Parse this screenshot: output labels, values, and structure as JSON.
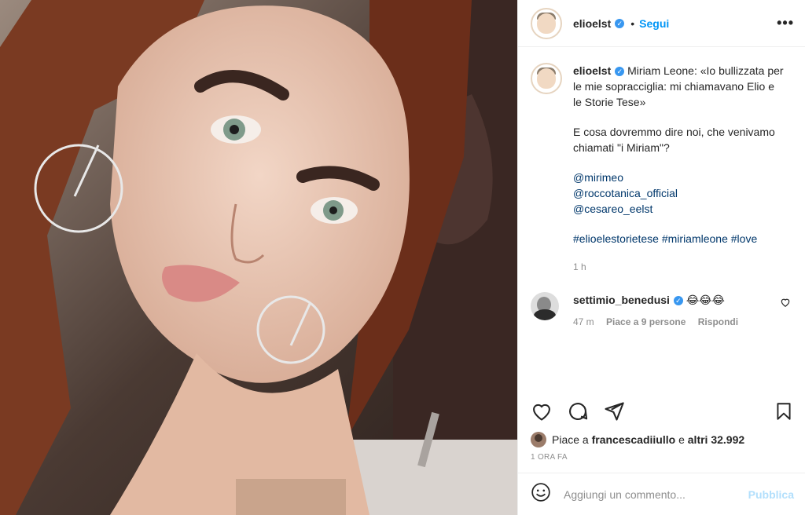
{
  "post_header": {
    "username": "elioelst",
    "dot": "•",
    "follow_label": "Segui",
    "more_label": "•••"
  },
  "caption": {
    "username": "elioelst",
    "text": "Miriam Leone: «Io bullizzata per le mie sopracciglia: mi chiamavano Elio e le Storie Tese»",
    "text2": "E cosa dovremmo dire noi, che venivamo chiamati \"i Miriam\"?",
    "mentions": [
      "@mirimeo",
      "@roccotanica_official",
      "@cesareo_eelst"
    ],
    "hashtags": "#elioelestorietese #miriamleone #love",
    "time": "1 h"
  },
  "comment": {
    "username": "settimio_benedusi",
    "text": "😂😂😂",
    "time": "47 m",
    "likes": "Piace a 9 persone",
    "reply": "Rispondi"
  },
  "likes": {
    "prefix": "Piace a",
    "user": "francescadiiullo",
    "middle": "e",
    "others": "altri 32.992"
  },
  "posted_ago": "1 ORA FA",
  "add_comment": {
    "placeholder": "Aggiungi un commento...",
    "publish_label": "Pubblica"
  },
  "icons": {
    "verified": "verified-icon",
    "like": "heart-icon",
    "comment": "comment-bubble-icon",
    "share": "paper-plane-icon",
    "save": "bookmark-icon",
    "emoji": "emoji-icon"
  },
  "colors": {
    "accent": "#0095f6",
    "verified": "#3897f0",
    "muted": "#8e8e8e",
    "publish_disabled": "#b2dffc"
  }
}
